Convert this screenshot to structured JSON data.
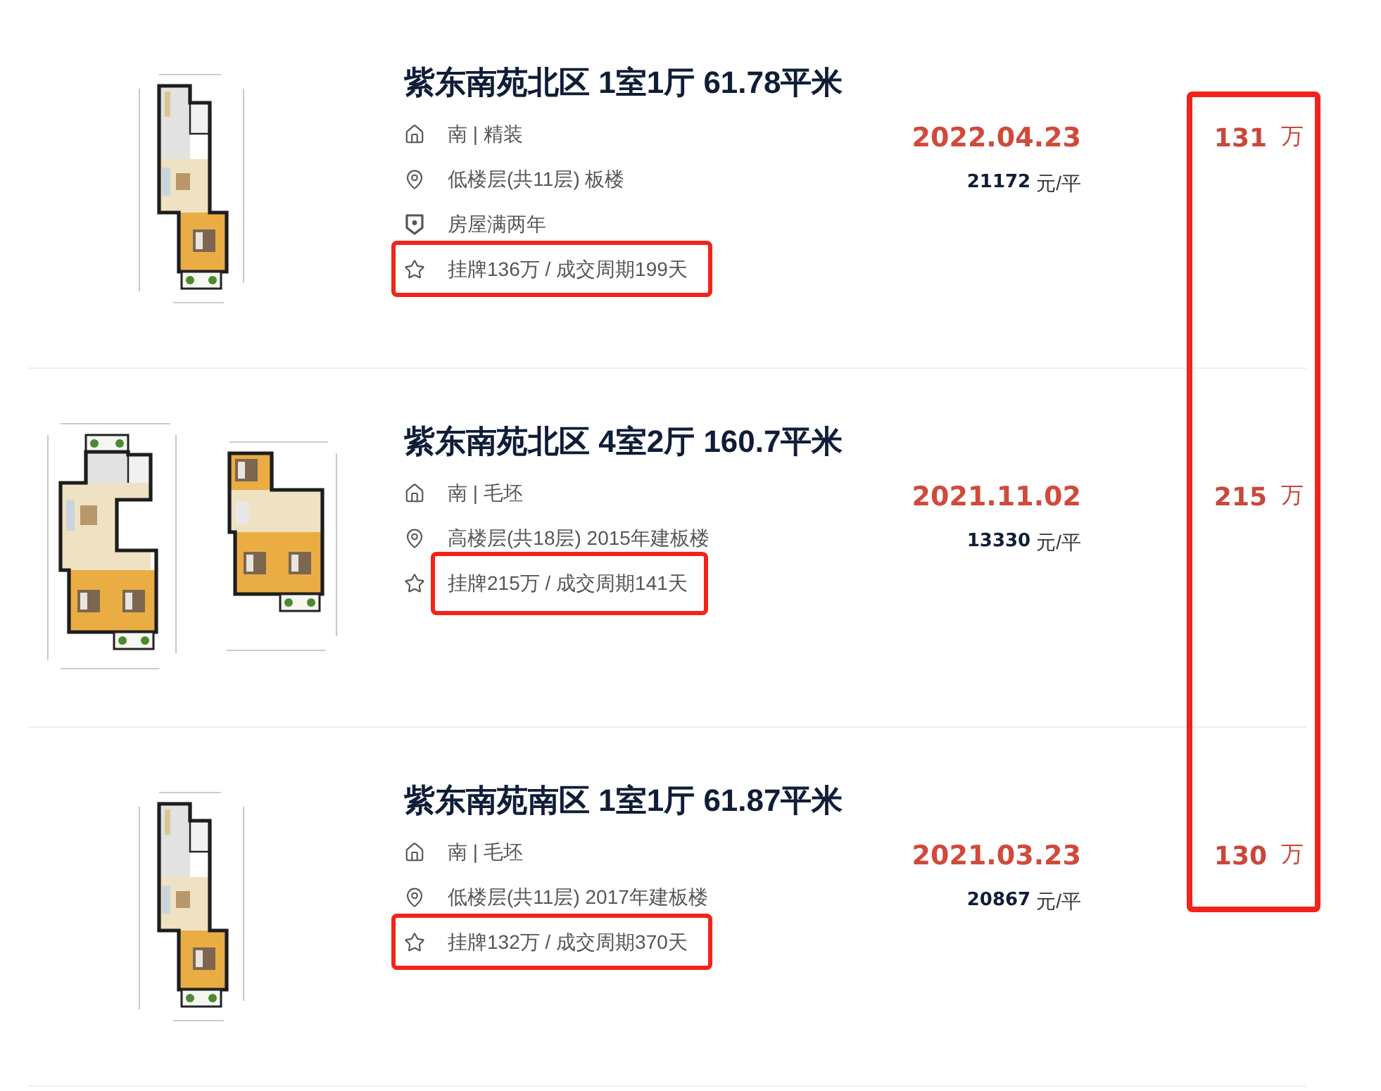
{
  "listings": [
    {
      "floor_plan": {
        "kind": "single"
      },
      "title": "紫东南苑北区 1室1厅 61.78平米",
      "details": [
        {
          "kind": "house",
          "text": "南 | 精装",
          "highlighted": false
        },
        {
          "kind": "location",
          "text": "低楼层(共11层) 板楼",
          "highlighted": false
        },
        {
          "kind": "certificate",
          "text": "房屋满两年",
          "highlighted": false
        },
        {
          "kind": "listing",
          "text": "挂牌136万 / 成交周期199天",
          "highlighted": true,
          "icon_framed": true
        }
      ],
      "deal_date": "2022.04.23",
      "unit_price": "21172",
      "unit_price_unit": "元/平",
      "total_price": "131",
      "total_price_unit": "万"
    },
    {
      "floor_plan": {
        "kind": "double"
      },
      "title": "紫东南苑北区 4室2厅 160.7平米",
      "details": [
        {
          "kind": "house",
          "text": "南 | 毛坯",
          "highlighted": false
        },
        {
          "kind": "location",
          "text": "高楼层(共18层) 2015年建板楼",
          "highlighted": false
        },
        {
          "kind": "listing",
          "text": "挂牌215万 / 成交周期141天",
          "highlighted": true,
          "icon_framed": false
        }
      ],
      "deal_date": "2021.11.02",
      "unit_price": "13330",
      "unit_price_unit": "元/平",
      "total_price": "215",
      "total_price_unit": "万"
    },
    {
      "floor_plan": {
        "kind": "single"
      },
      "title": "紫东南苑南区 1室1厅 61.87平米",
      "details": [
        {
          "kind": "house",
          "text": "南 | 毛坯",
          "highlighted": false
        },
        {
          "kind": "location",
          "text": "低楼层(共11层) 2017年建板楼",
          "highlighted": false
        },
        {
          "kind": "listing",
          "text": "挂牌132万 / 成交周期370天",
          "highlighted": true,
          "icon_framed": true
        }
      ],
      "deal_date": "2021.03.23",
      "unit_price": "20867",
      "unit_price_unit": "元/平",
      "total_price": "130",
      "total_price_unit": "万"
    }
  ],
  "price_column": {
    "highlighted": true
  }
}
